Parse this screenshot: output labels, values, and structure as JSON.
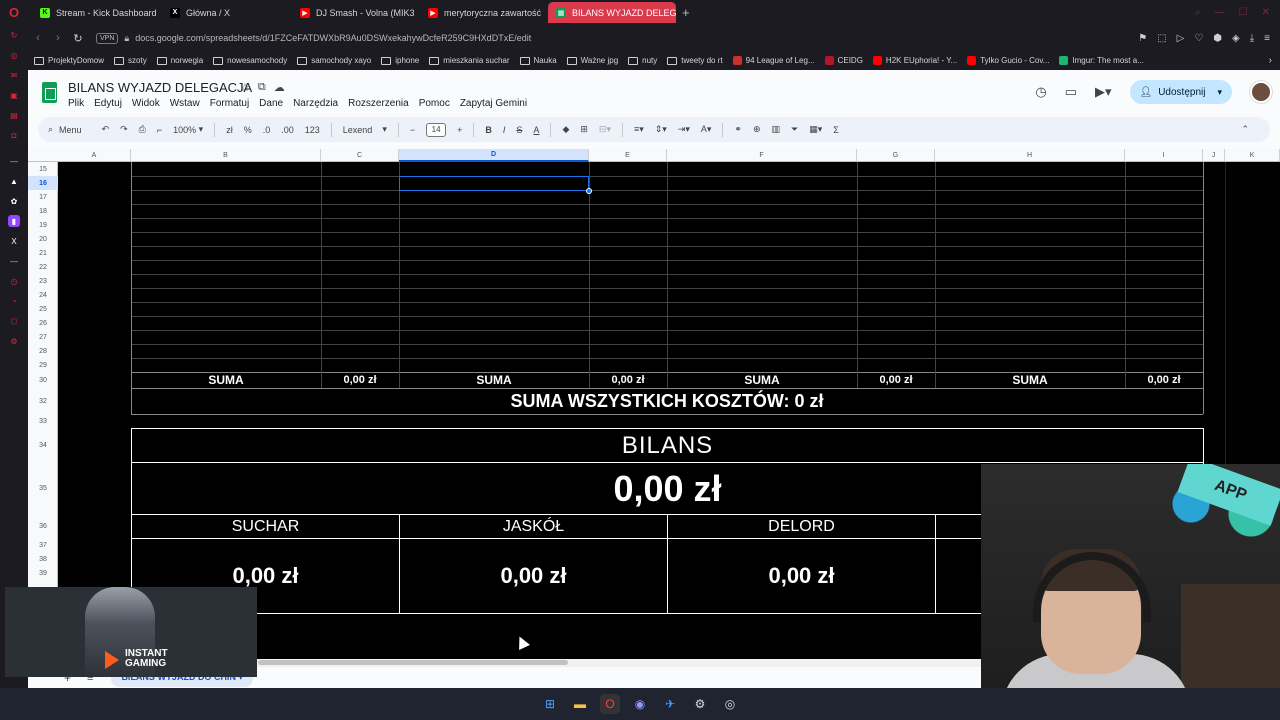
{
  "browser": {
    "tabs": [
      {
        "label": "Stream - Kick Dashboard",
        "color": "#53fc18",
        "glyph": "K"
      },
      {
        "label": "Główna / X",
        "color": "#000000",
        "glyph": "X"
      },
      {
        "label": "DJ Smash - Volna (MIK3",
        "color": "#ff0000",
        "glyph": "▶"
      },
      {
        "label": "merytoryczna zawartość",
        "color": "#ff0000",
        "glyph": "▶"
      },
      {
        "label": "BILANS WYJAZD DELEGA",
        "color": "#0f9d58",
        "glyph": "▦",
        "active": true
      }
    ],
    "url": "docs.google.com/spreadsheets/d/1FZCeFATDWXbR9Au0DSWxekahywDcfeR259C9HXdDTxE/edit",
    "vpn_label": "VPN",
    "bookmarks": [
      {
        "label": "ProjektyDomow",
        "type": "folder"
      },
      {
        "label": "szoty",
        "type": "folder"
      },
      {
        "label": "norwegia",
        "type": "folder"
      },
      {
        "label": "nowesamochody",
        "type": "folder"
      },
      {
        "label": "samochody xayo",
        "type": "folder"
      },
      {
        "label": "iphone",
        "type": "folder"
      },
      {
        "label": "mieszkania suchar",
        "type": "folder"
      },
      {
        "label": "Nauka",
        "type": "folder"
      },
      {
        "label": "Ważne jpg",
        "type": "folder"
      },
      {
        "label": "nuty",
        "type": "folder"
      },
      {
        "label": "tweety do rt",
        "type": "folder"
      },
      {
        "label": "94 League of Leg...",
        "type": "site",
        "color": "#c8322a"
      },
      {
        "label": "CEIDG",
        "type": "site",
        "color": "#b5152b"
      },
      {
        "label": "H2K EUphoria! - Y...",
        "type": "site",
        "color": "#ff0000"
      },
      {
        "label": "Tylko Gucio - Cov...",
        "type": "site",
        "color": "#ff0000"
      },
      {
        "label": "Imgur: The most a...",
        "type": "site",
        "color": "#1bb76e"
      }
    ]
  },
  "sheets": {
    "title": "BILANS WYJAZD DELEGACJA",
    "menu": [
      "Plik",
      "Edytuj",
      "Widok",
      "Wstaw",
      "Formatuj",
      "Dane",
      "Narzędzia",
      "Rozszerzenia",
      "Pomoc",
      "Zapytaj Gemini"
    ],
    "share_label": "Udostępnij",
    "toolbar": {
      "search_label": "Menu",
      "zoom": "100%",
      "percent": "%",
      "dec_minus": ".0",
      "dec_plus": ".00",
      "number_format": "123",
      "font": "Lexend",
      "font_size": "14"
    },
    "columns": [
      "A",
      "B",
      "C",
      "D",
      "E",
      "F",
      "G",
      "H",
      "I",
      "J",
      "K"
    ],
    "rows": [
      "15",
      "16",
      "17",
      "18",
      "19",
      "20",
      "21",
      "22",
      "23",
      "24",
      "25",
      "26",
      "27",
      "28",
      "29",
      "30",
      "32",
      "33",
      "34",
      "35",
      "36",
      "37",
      "38",
      "39"
    ],
    "sum_label": "SUMA",
    "sum_value": "0,00 zł",
    "total_label": "SUMA WSZYSTKICH KOSZTÓW: 0 zł",
    "balance_title": "BILANS",
    "balance_value": "0,00 zł",
    "people": [
      {
        "name": "SUCHAR",
        "value": "0,00 zł"
      },
      {
        "name": "JASKÓŁ",
        "value": "0,00 zł"
      },
      {
        "name": "DELORD",
        "value": "0,00 zł"
      }
    ],
    "sheet_tab": "BILANS WYJAZD DO CHIN"
  },
  "overlay": {
    "ad_line1": "INSTANT",
    "ad_line2": "GAMING",
    "webcam_banner": "APP"
  }
}
